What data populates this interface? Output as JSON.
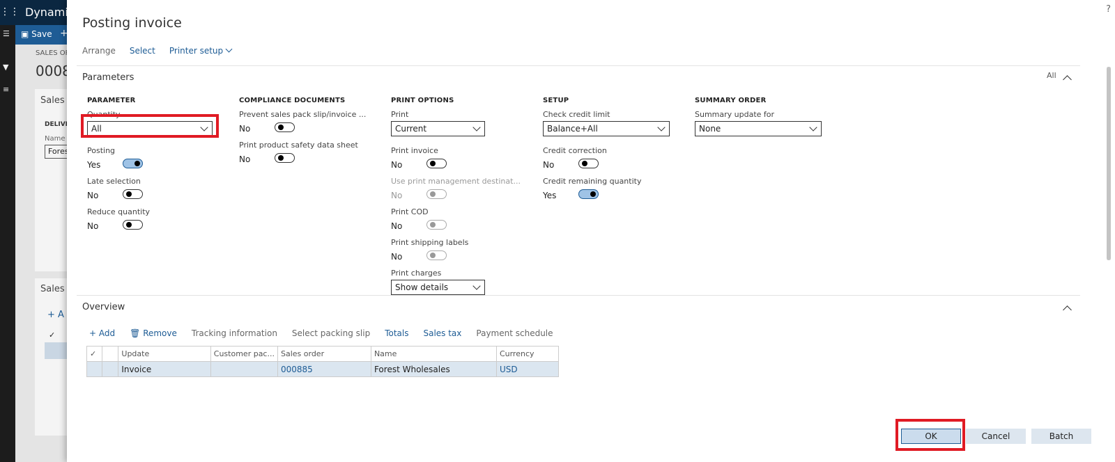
{
  "background": {
    "brand": "Dynamic",
    "save_label": "Save",
    "breadcrumb": "SALES OR",
    "order_partial": "0008",
    "card1_title": "Sales o",
    "card1_group": "DELIVE",
    "card1_name_label": "Name",
    "card1_name_value": "Fores",
    "card2_title": "Sales o",
    "card2_add": "+ A"
  },
  "dialog": {
    "title": "Posting invoice",
    "help": "?",
    "toolbar": [
      {
        "label": "Arrange",
        "enabled": false
      },
      {
        "label": "Select",
        "enabled": true
      },
      {
        "label": "Printer setup",
        "enabled": true
      }
    ],
    "parameters": {
      "header": "Parameters",
      "all_label": "All",
      "groups": {
        "parameter": {
          "title": "PARAMETER",
          "quantity_label": "Quantity",
          "quantity_value": "All",
          "posting_label": "Posting",
          "posting_value": "Yes",
          "late_selection_label": "Late selection",
          "late_selection_value": "No",
          "reduce_quantity_label": "Reduce quantity",
          "reduce_quantity_value": "No"
        },
        "compliance": {
          "title": "COMPLIANCE DOCUMENTS",
          "prevent_label": "Prevent sales pack slip/invoice ...",
          "prevent_value": "No",
          "safety_label": "Print product safety data sheet",
          "safety_value": "No"
        },
        "print_options": {
          "title": "PRINT OPTIONS",
          "print_label": "Print",
          "print_value": "Current",
          "print_invoice_label": "Print invoice",
          "print_invoice_value": "No",
          "use_pm_label": "Use print management destinat...",
          "use_pm_value": "No",
          "print_cod_label": "Print COD",
          "print_cod_value": "No",
          "shipping_labels_label": "Print shipping labels",
          "shipping_labels_value": "No",
          "print_charges_label": "Print charges",
          "print_charges_value": "Show details"
        },
        "setup": {
          "title": "SETUP",
          "credit_limit_label": "Check credit limit",
          "credit_limit_value": "Balance+All",
          "credit_correction_label": "Credit correction",
          "credit_correction_value": "No",
          "credit_remaining_label": "Credit remaining quantity",
          "credit_remaining_value": "Yes"
        },
        "summary": {
          "title": "SUMMARY ORDER",
          "summary_update_label": "Summary update for",
          "summary_update_value": "None"
        }
      }
    },
    "overview": {
      "header": "Overview",
      "toolbar": {
        "add": "Add",
        "remove": "Remove",
        "tracking": "Tracking information",
        "packing_slip": "Select packing slip",
        "totals": "Totals",
        "sales_tax": "Sales tax",
        "payment_schedule": "Payment schedule"
      },
      "columns": [
        "Update",
        "Customer pac...",
        "Sales order",
        "Name",
        "Currency"
      ],
      "rows": [
        {
          "update": "Invoice",
          "customer_pack": "",
          "sales_order": "000885",
          "name": "Forest Wholesales",
          "currency": "USD"
        }
      ]
    },
    "buttons": {
      "ok": "OK",
      "cancel": "Cancel",
      "batch": "Batch"
    }
  },
  "colors": {
    "accent": "#1e5c95",
    "highlight": "#e01b24",
    "topbar": "#0b2741"
  }
}
